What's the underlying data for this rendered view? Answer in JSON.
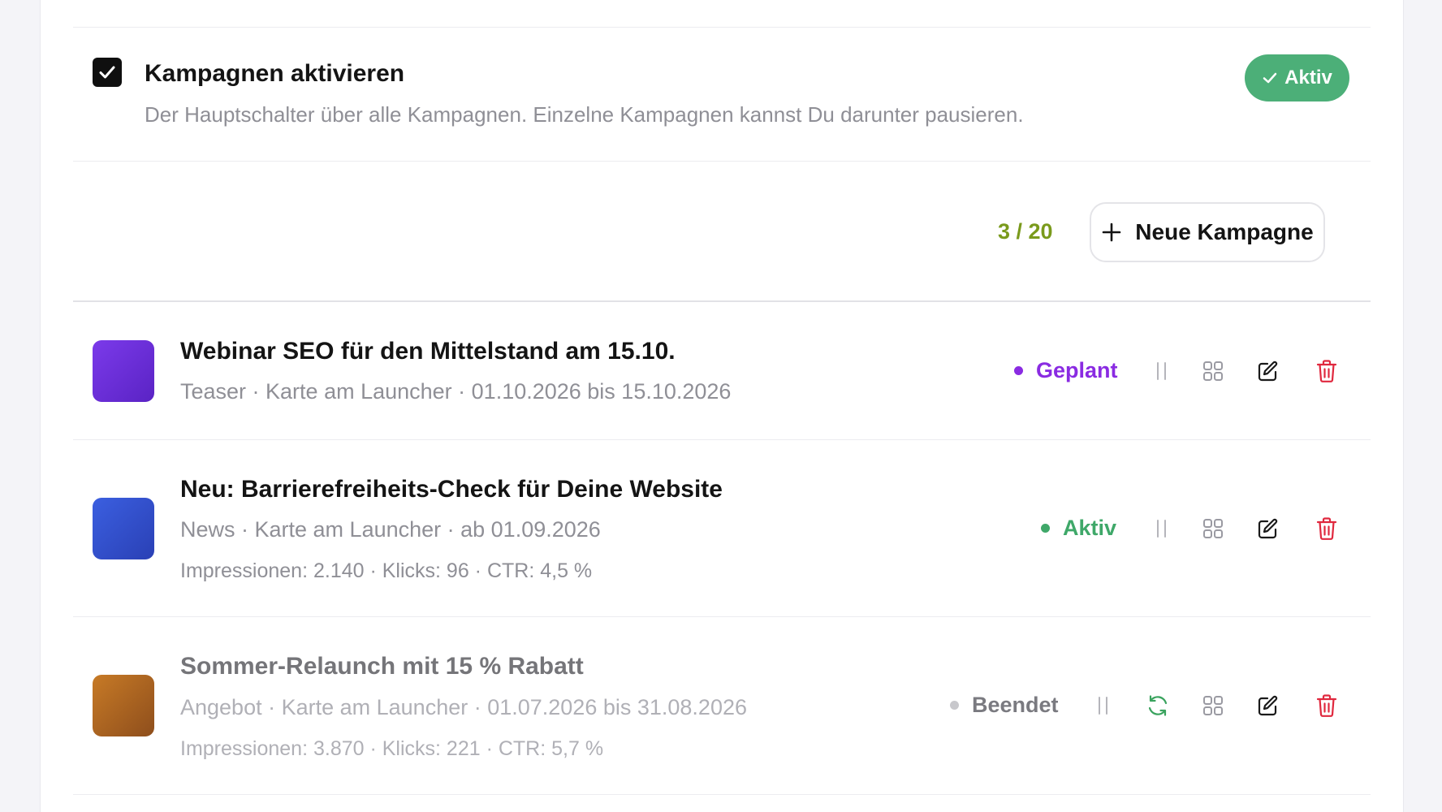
{
  "master": {
    "checked": true,
    "title": "Kampagnen aktivieren",
    "description": "Der Hauptschalter über alle Kampagnen. Einzelne Kampagnen kannst Du darunter pausieren.",
    "status_label": "Aktiv"
  },
  "toolbar": {
    "counter": "3 / 20",
    "new_button_label": "Neue Kampagne"
  },
  "campaigns": [
    {
      "title": "Webinar SEO für den Mittelstand am 15.10.",
      "meta": "Teaser · Karte am Launcher · 01.10.2026 bis 15.10.2026",
      "stats": "",
      "status": "Geplant",
      "status_color": "#8a2be2",
      "thumb_gradient": [
        "#7b3aea",
        "#5a23c4"
      ]
    },
    {
      "title": "Neu: Barrierefreiheits-Check für Deine Website",
      "meta": "News · Karte am Launcher · ab 01.09.2026",
      "stats": "Impressionen: 2.140 · Klicks: 96 · CTR: 4,5 %",
      "status": "Aktiv",
      "status_color": "#3fa869",
      "thumb_gradient": [
        "#3b5fe0",
        "#2a40b5"
      ]
    },
    {
      "title": "Sommer-Relaunch mit 15 % Rabatt",
      "meta": "Angebot · Karte am Launcher · 01.07.2026 bis 31.08.2026",
      "stats": "Impressionen: 3.870 · Klicks: 221 · CTR: 5,7 %",
      "status": "Beendet",
      "status_color": "#c8c8cc",
      "thumb_gradient": [
        "#c77a26",
        "#8e4e1c"
      ]
    }
  ],
  "icons": {
    "pause": "pause-icon",
    "restart": "refresh-icon",
    "grid": "grid-icon",
    "edit": "edit-icon",
    "delete": "trash-icon"
  },
  "colors": {
    "accent_green": "#4caf78",
    "counter_green": "#7a9a1c",
    "delete_red": "#e0283e",
    "restart_green": "#3aa35e"
  }
}
